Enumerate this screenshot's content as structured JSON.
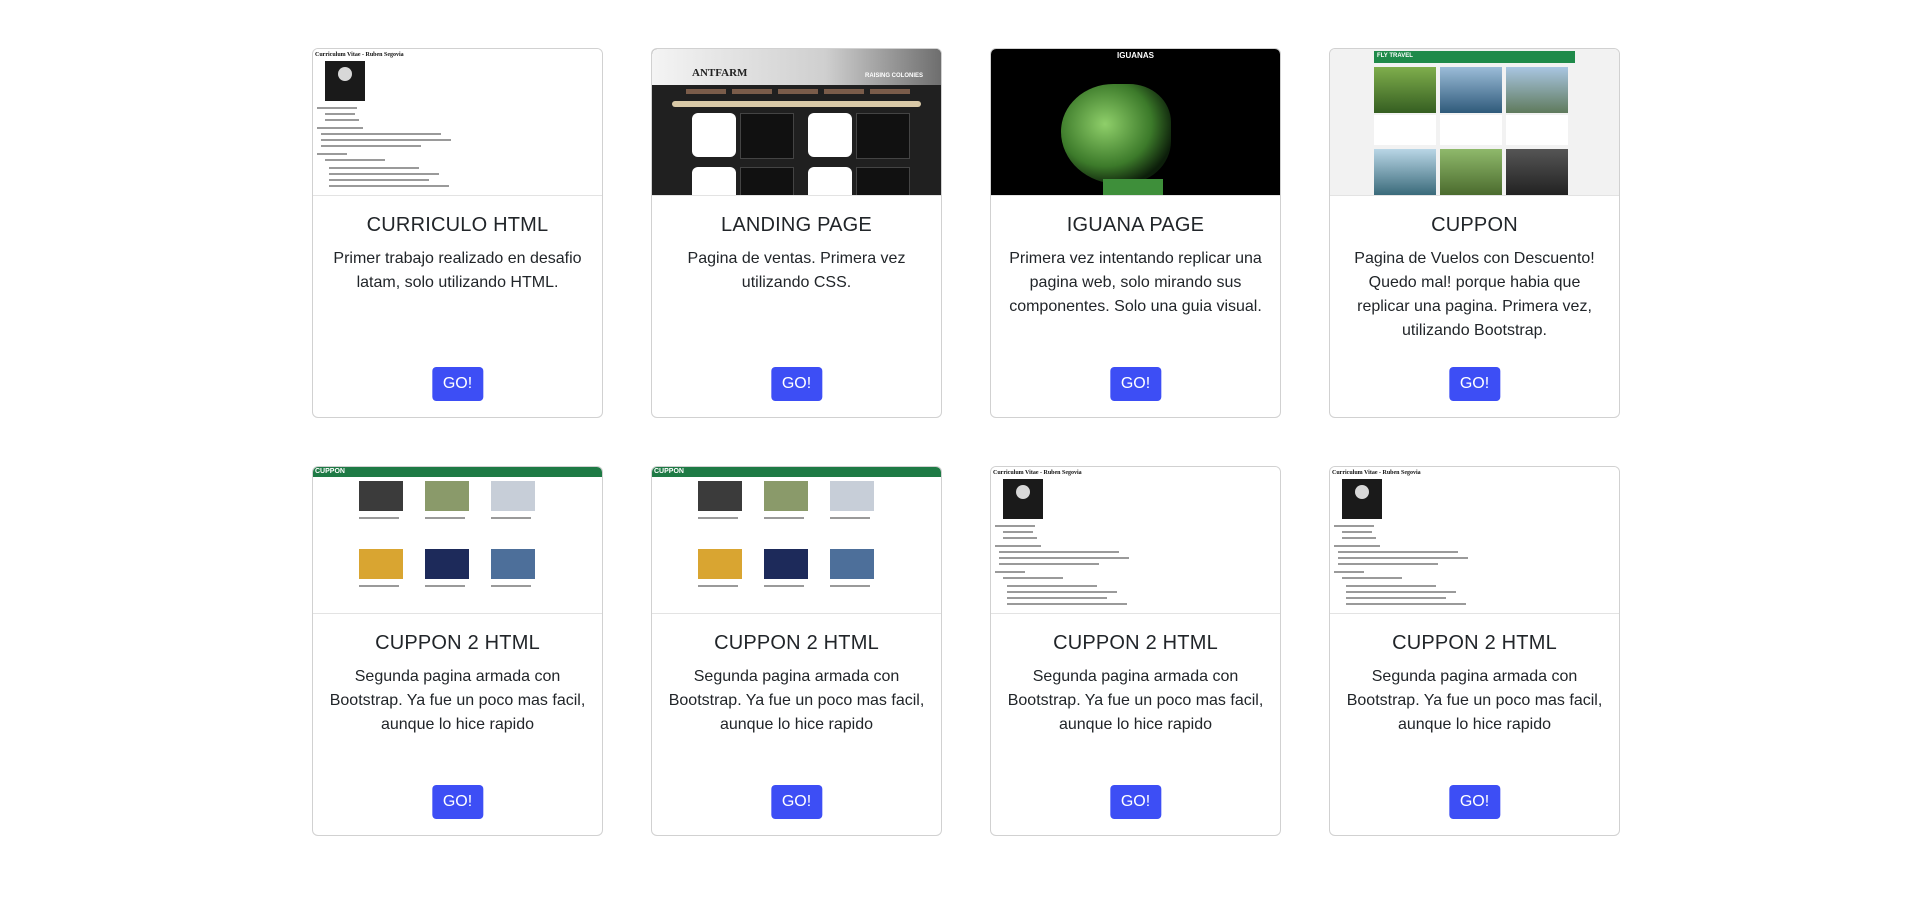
{
  "cards": [
    {
      "title": "CURRICULO HTML",
      "text": "Primer trabajo realizado en desafio latam, solo utilizando HTML.",
      "button": "GO!",
      "thumb": "cv"
    },
    {
      "title": "LANDING PAGE",
      "text": "Pagina de ventas. Primera vez utilizando CSS.",
      "button": "GO!",
      "thumb": "antfarm"
    },
    {
      "title": "IGUANA PAGE",
      "text": "Primera vez intentando replicar una pagina web, solo mirando sus componentes. Solo una guia visual.",
      "button": "GO!",
      "thumb": "iguana"
    },
    {
      "title": "CUPPON",
      "text": "Pagina de Vuelos con Descuento! Quedo mal! porque habia que replicar una pagina. Primera vez, utilizando Bootstrap.",
      "button": "GO!",
      "thumb": "flytravel"
    },
    {
      "title": "CUPPON 2 HTML",
      "text": "Segunda pagina armada con Bootstrap. Ya fue un poco mas facil, aunque lo hice rapido",
      "button": "GO!",
      "thumb": "cuppon"
    },
    {
      "title": "CUPPON 2 HTML",
      "text": "Segunda pagina armada con Bootstrap. Ya fue un poco mas facil, aunque lo hice rapido",
      "button": "GO!",
      "thumb": "cuppon"
    },
    {
      "title": "CUPPON 2 HTML",
      "text": "Segunda pagina armada con Bootstrap. Ya fue un poco mas facil, aunque lo hice rapido",
      "button": "GO!",
      "thumb": "cv"
    },
    {
      "title": "CUPPON 2 HTML",
      "text": "Segunda pagina armada con Bootstrap. Ya fue un poco mas facil, aunque lo hice rapido",
      "button": "GO!",
      "thumb": "cv"
    }
  ],
  "thumbs": {
    "cv_heading": "Curriculum Vitae - Ruben Segovia",
    "ant_brand": "ANTFARM",
    "ant_tag": "RAISING COLONIES",
    "iguana_title": "IGUANAS",
    "fly_brand": "FLY TRAVEL",
    "cuppon_brand": "CUPPON"
  },
  "colors": {
    "button": "#3d4ef5",
    "brand_green": "#1e7a45"
  }
}
